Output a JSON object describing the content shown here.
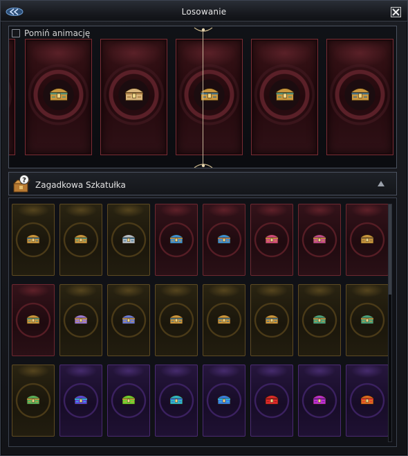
{
  "window": {
    "title": "Losowanie"
  },
  "header": {
    "back_icon": "double-arrow-left-icon",
    "close_icon": "close-x-icon"
  },
  "roulette": {
    "skip_animation_label": "Pomiń animację",
    "skip_animation_checked": false,
    "reel": [
      {
        "chest_color": "#c9963d",
        "accent": "#3b6e8a"
      },
      {
        "chest_color": "#c9963d",
        "accent": "#4a8f7a"
      },
      {
        "chest_color": "#d8b47a",
        "accent": "#a57a40"
      },
      {
        "chest_color": "#c9963d",
        "accent": "#3b6e8a"
      },
      {
        "chest_color": "#c9963d",
        "accent": "#4a8f7a"
      }
    ]
  },
  "section": {
    "title": "Zagadkowa Szkatułka",
    "icon": "mystery-box-icon"
  },
  "grid": {
    "items": [
      {
        "frame": "gold",
        "chest": "#c9963d",
        "accent": "#3b6e8a"
      },
      {
        "frame": "gold",
        "chest": "#c9963d",
        "accent": "#4a8f7a"
      },
      {
        "frame": "gold",
        "chest": "#b8c0c8",
        "accent": "#3b6e8a"
      },
      {
        "frame": "red",
        "chest": "#3e8fd0",
        "accent": "#c9963d"
      },
      {
        "frame": "red",
        "chest": "#3e8fd0",
        "accent": "#c07a45"
      },
      {
        "frame": "red",
        "chest": "#d04a7a",
        "accent": "#c9963d"
      },
      {
        "frame": "red",
        "chest": "#c04a8a",
        "accent": "#c9963d"
      },
      {
        "frame": "red",
        "chest": "#c9963d",
        "accent": "#8a6a3a"
      },
      {
        "frame": "red",
        "chest": "#c9963d",
        "accent": "#4a8f7a"
      },
      {
        "frame": "gold",
        "chest": "#9a7ad0",
        "accent": "#c9963d"
      },
      {
        "frame": "gold",
        "chest": "#6a7ad0",
        "accent": "#c9963d"
      },
      {
        "frame": "gold",
        "chest": "#c9963d",
        "accent": "#3b6e8a"
      },
      {
        "frame": "gold",
        "chest": "#c9963d",
        "accent": "#3b6e8a"
      },
      {
        "frame": "gold",
        "chest": "#c9963d",
        "accent": "#3b6e8a"
      },
      {
        "frame": "gold",
        "chest": "#4aa07a",
        "accent": "#c9963d"
      },
      {
        "frame": "gold",
        "chest": "#4aa07a",
        "accent": "#c9963d"
      },
      {
        "frame": "gold",
        "chest": "#5ab05a",
        "accent": "#c9963d"
      },
      {
        "frame": "purple",
        "chest": "#5a4ad8",
        "accent": "#30c0e0"
      },
      {
        "frame": "purple",
        "chest": "#70d030",
        "accent": "#c9963d"
      },
      {
        "frame": "purple",
        "chest": "#30b8c8",
        "accent": "#3a6ad0"
      },
      {
        "frame": "purple",
        "chest": "#3a80e0",
        "accent": "#30c0e0"
      },
      {
        "frame": "purple",
        "chest": "#e02a2a",
        "accent": "#a01a1a"
      },
      {
        "frame": "purple",
        "chest": "#c030d0",
        "accent": "#7a20a0"
      },
      {
        "frame": "purple",
        "chest": "#e06a20",
        "accent": "#e03030"
      }
    ]
  }
}
